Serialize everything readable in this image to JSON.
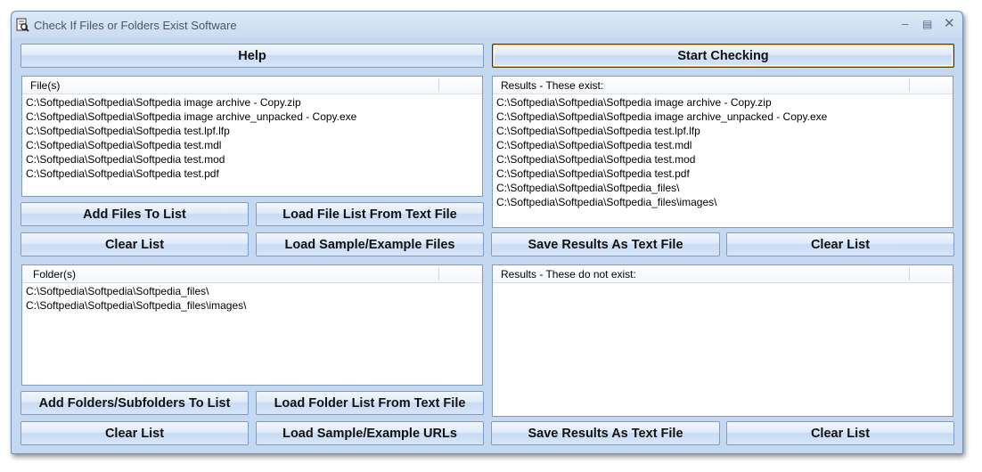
{
  "window": {
    "title": "Check If Files or Folders Exist Software"
  },
  "toolbar": {
    "help_label": "Help",
    "start_label": "Start Checking"
  },
  "files": {
    "header": "File(s)",
    "items": [
      "C:\\Softpedia\\Softpedia\\Softpedia image archive - Copy.zip",
      "C:\\Softpedia\\Softpedia\\Softpedia image archive_unpacked - Copy.exe",
      "C:\\Softpedia\\Softpedia\\Softpedia test.lpf.lfp",
      "C:\\Softpedia\\Softpedia\\Softpedia test.mdl",
      "C:\\Softpedia\\Softpedia\\Softpedia test.mod",
      "C:\\Softpedia\\Softpedia\\Softpedia test.pdf"
    ],
    "add_label": "Add Files To List",
    "load_label": "Load File List From Text File",
    "clear_label": "Clear List",
    "sample_label": "Load Sample/Example Files"
  },
  "folders": {
    "header": "Folder(s)",
    "items": [
      "C:\\Softpedia\\Softpedia\\Softpedia_files\\",
      "C:\\Softpedia\\Softpedia\\Softpedia_files\\images\\"
    ],
    "add_label": "Add Folders/Subfolders To List",
    "load_label": "Load Folder List From Text File",
    "clear_label": "Clear List",
    "sample_label": "Load Sample/Example URLs"
  },
  "results_exist": {
    "header": "Results - These exist:",
    "items": [
      "C:\\Softpedia\\Softpedia\\Softpedia image archive - Copy.zip",
      "C:\\Softpedia\\Softpedia\\Softpedia image archive_unpacked - Copy.exe",
      "C:\\Softpedia\\Softpedia\\Softpedia test.lpf.lfp",
      "C:\\Softpedia\\Softpedia\\Softpedia test.mdl",
      "C:\\Softpedia\\Softpedia\\Softpedia test.mod",
      "C:\\Softpedia\\Softpedia\\Softpedia test.pdf",
      "C:\\Softpedia\\Softpedia\\Softpedia_files\\",
      "C:\\Softpedia\\Softpedia\\Softpedia_files\\images\\"
    ],
    "save_label": "Save Results As Text File",
    "clear_label": "Clear List"
  },
  "results_not_exist": {
    "header": "Results - These do not exist:",
    "items": [],
    "save_label": "Save Results As Text File",
    "clear_label": "Clear List"
  },
  "colors": {
    "window_bg": "#c4d9f1",
    "button_border": "#7c9ccc",
    "list_border": "#7f9db9"
  }
}
